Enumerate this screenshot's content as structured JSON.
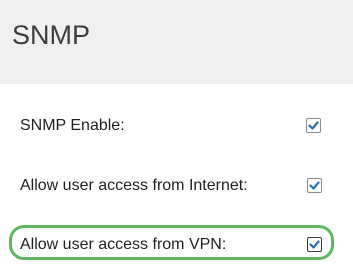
{
  "header": {
    "title": "SNMP"
  },
  "settings": [
    {
      "label": "SNMP Enable:",
      "checked": true
    },
    {
      "label": "Allow user access from Internet:",
      "checked": true
    },
    {
      "label": "Allow user access from VPN:",
      "checked": true
    }
  ],
  "colors": {
    "header_bg": "#f0f0f0",
    "checkmark": "#2a6fb5",
    "highlight": "#5cb85c"
  }
}
